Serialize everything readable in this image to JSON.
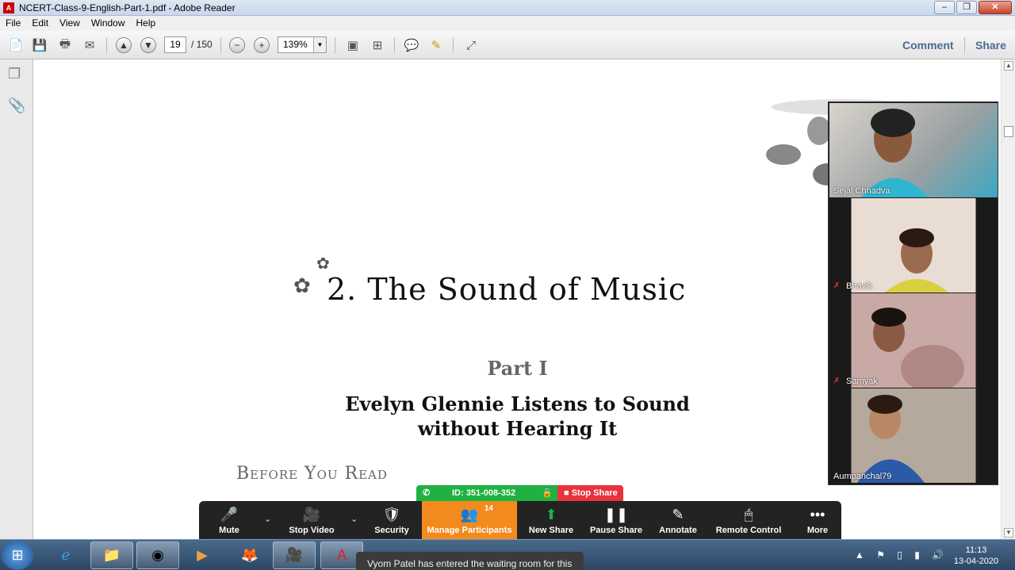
{
  "window": {
    "title": "NCERT-Class-9-English-Part-1.pdf - Adobe Reader",
    "minimize": "–",
    "restore": "❐",
    "close": "✕"
  },
  "menu": [
    "File",
    "Edit",
    "View",
    "Window",
    "Help"
  ],
  "toolbar": {
    "page_current": "19",
    "page_total": "/ 150",
    "zoom": "139%",
    "comment_label": "Comment",
    "share_label": "Share"
  },
  "document": {
    "chapter_title": "2. The Sound of Music",
    "part": "Part I",
    "subtitle_line1": "Evelyn Glennie Listens to Sound",
    "subtitle_line2": "without Hearing It",
    "section": "Before You Read"
  },
  "participants_video": [
    {
      "name": "Sejal Chhadva",
      "muted": false,
      "color": "#3aa8c2"
    },
    {
      "name": "Bhavik",
      "muted": true,
      "color": "#e8d8cc"
    },
    {
      "name": "Samyak",
      "muted": true,
      "color": "#c9a9a6"
    },
    {
      "name": "Aumpanchal79",
      "muted": false,
      "color": "#b5a89c"
    }
  ],
  "share_status": {
    "meeting_id": "ID: 351-008-352",
    "stop_share": "Stop Share"
  },
  "zoom_controls": {
    "mute": "Mute",
    "stop_video": "Stop Video",
    "security": "Security",
    "manage_participants": "Manage Participants",
    "participant_count": "14",
    "new_share": "New Share",
    "pause_share": "Pause Share",
    "annotate": "Annotate",
    "remote_control": "Remote Control",
    "more": "More"
  },
  "notification": "Vyom Patel has entered the waiting room for this",
  "taskbar": {
    "time": "11:13",
    "date": "13-04-2020"
  },
  "colors": {
    "zoom_active": "#f28a1d",
    "stop_share": "#e8333e",
    "id_bar": "#1fb141",
    "reader_accent": "#4a6a96"
  }
}
